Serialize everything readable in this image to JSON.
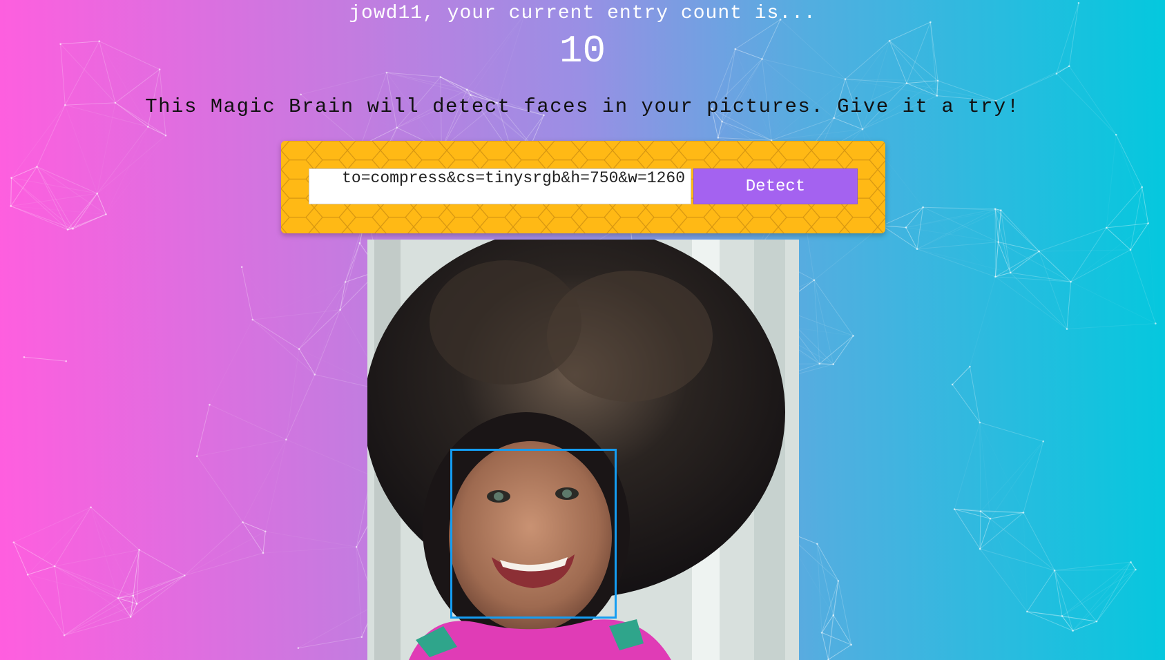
{
  "header": {
    "greeting": "jowd11, your current entry count is...",
    "entry_count": "10"
  },
  "tagline": "This Magic Brain will detect faces in your pictures. Give it a try!",
  "form": {
    "url_value": "to=compress&cs=tinysrgb&h=750&w=1260",
    "detect_label": "Detect"
  },
  "colors": {
    "gradient_left": "#ff5edf",
    "gradient_right": "#04c8de",
    "panel": "#ffb915",
    "button": "#a462f0",
    "face_box": "#149df2"
  }
}
